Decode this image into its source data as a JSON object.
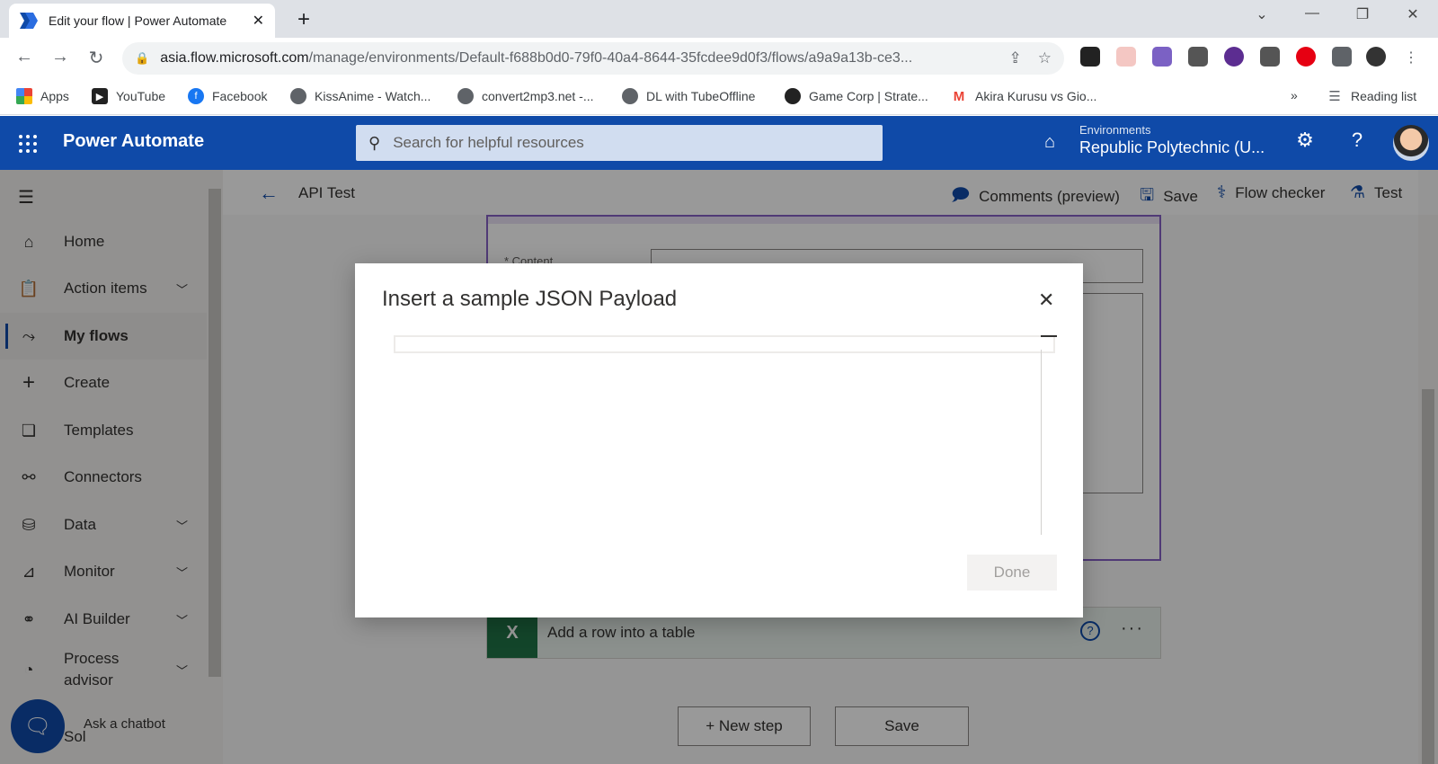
{
  "browser": {
    "tab_title": "Edit your flow | Power Automate",
    "url_host": "asia.flow.microsoft.com",
    "url_path": "/manage/environments/Default-f688b0d0-79f0-40a4-8644-35fcdee9d0f3/flows/a9a9a13b-ce3...",
    "bookmarks": [
      "Apps",
      "YouTube",
      "Facebook",
      "KissAnime - Watch...",
      "convert2mp3.net -...",
      "DL with TubeOffline",
      "Game Corp | Strate...",
      "Akira Kurusu vs Gio..."
    ],
    "reading_list": "Reading list",
    "more": "»"
  },
  "header": {
    "app_name": "Power Automate",
    "search_placeholder": "Search for helpful resources",
    "env_label": "Environments",
    "env_name": "Republic Polytechnic (U..."
  },
  "sidebar": {
    "items": [
      {
        "label": "Home",
        "icon": "home-icon"
      },
      {
        "label": "Action items",
        "icon": "clipboard-icon"
      },
      {
        "label": "My flows",
        "icon": "flow-icon"
      },
      {
        "label": "Create",
        "icon": "plus-icon"
      },
      {
        "label": "Templates",
        "icon": "templates-icon"
      },
      {
        "label": "Connectors",
        "icon": "connector-icon"
      },
      {
        "label": "Data",
        "icon": "database-icon"
      },
      {
        "label": "Monitor",
        "icon": "monitor-icon"
      },
      {
        "label": "AI Builder",
        "icon": "ai-icon"
      },
      {
        "label": "Process advisor",
        "icon": "process-icon"
      }
    ],
    "chatbot_label": "Ask a chatbot",
    "truncated_item": "Sol"
  },
  "commandbar": {
    "flow_name": "API Test",
    "comments": "Comments (preview)",
    "save": "Save",
    "flow_checker": "Flow checker",
    "test": "Test"
  },
  "canvas": {
    "card1_field_label": "* Content",
    "card2_title": "Add a row into a table",
    "card2_help": "?",
    "card2_more": "···",
    "new_step": "+ New step",
    "save": "Save"
  },
  "modal": {
    "title": "Insert a sample JSON Payload",
    "done": "Done"
  },
  "colors": {
    "brand": "#0f4aa8",
    "excel": "#217346",
    "parse_json": "#8661c5"
  }
}
